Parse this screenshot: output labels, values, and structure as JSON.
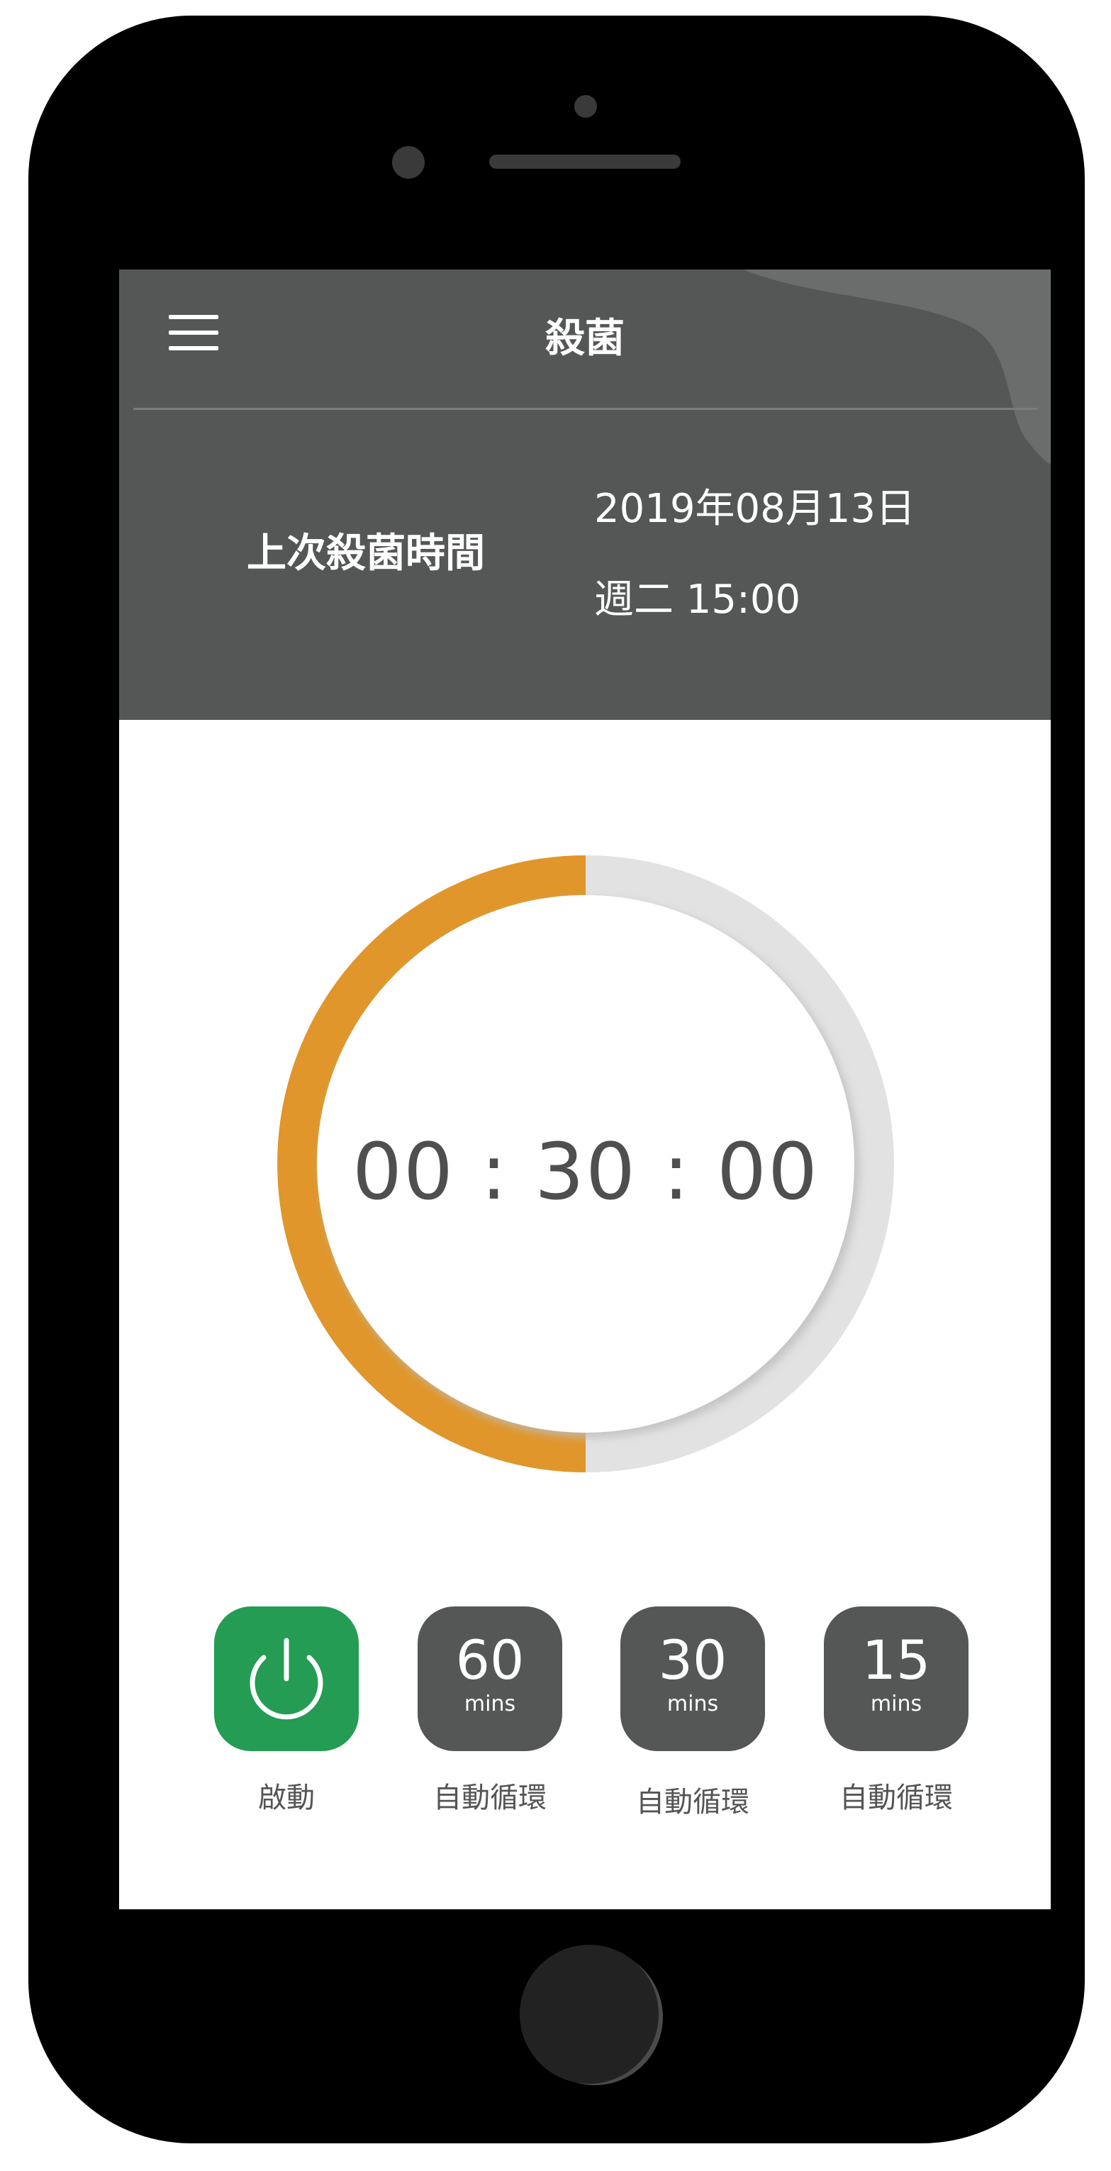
{
  "app": {
    "title": "殺菌"
  },
  "last_sterilization": {
    "label": "上次殺菌時間",
    "date": "2019年08月13日",
    "weekday_time": "週二 15:00"
  },
  "timer": {
    "display": "00 : 30 : 00",
    "progress_fraction": 0.5,
    "progress_color": "#E0962A",
    "track_color": "#E2E2E2"
  },
  "controls": {
    "start": {
      "icon": "power-icon",
      "label": "啟動",
      "color": "#249C54"
    },
    "presets": [
      {
        "value": "60",
        "unit": "mins",
        "label": "自動循環"
      },
      {
        "value": "30",
        "unit": "mins",
        "label": "自動循環"
      },
      {
        "value": "15",
        "unit": "mins",
        "label": "自動循環"
      }
    ],
    "preset_color": "#555756"
  },
  "colors": {
    "header": "#555756",
    "phone_frame": "#000000"
  }
}
